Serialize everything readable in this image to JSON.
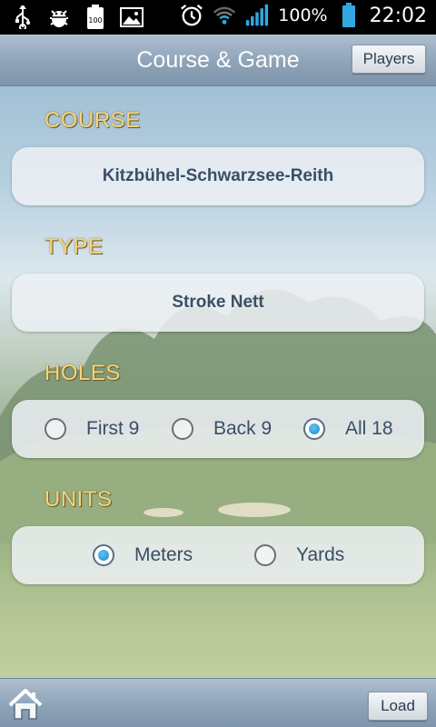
{
  "status_bar": {
    "battery_icon_text": "100",
    "battery_percent": "100%",
    "time": "22:02",
    "icons": [
      "usb-icon",
      "android-debug-icon",
      "battery-full-icon",
      "image-icon",
      "alarm-clock-icon",
      "wifi-icon",
      "signal-icon",
      "battery-icon"
    ]
  },
  "header": {
    "title": "Course & Game",
    "players_button": "Players"
  },
  "sections": {
    "course": {
      "label": "COURSE",
      "value": "Kitzbühel-Schwarzsee-Reith"
    },
    "type": {
      "label": "TYPE",
      "value": "Stroke Nett"
    },
    "holes": {
      "label": "HOLES",
      "options": [
        {
          "label": "First 9",
          "selected": false
        },
        {
          "label": "Back 9",
          "selected": false
        },
        {
          "label": "All 18",
          "selected": true
        }
      ]
    },
    "units": {
      "label": "UNITS",
      "options": [
        {
          "label": "Meters",
          "selected": true
        },
        {
          "label": "Yards",
          "selected": false
        }
      ]
    }
  },
  "footer": {
    "load_button": "Load",
    "home_icon": "home-icon"
  },
  "colors": {
    "label_gold": "#f3d57c",
    "value_text": "#3a4f66",
    "bar_blue": "#8ea3b8",
    "radio_selected": "#1d8ccf"
  }
}
